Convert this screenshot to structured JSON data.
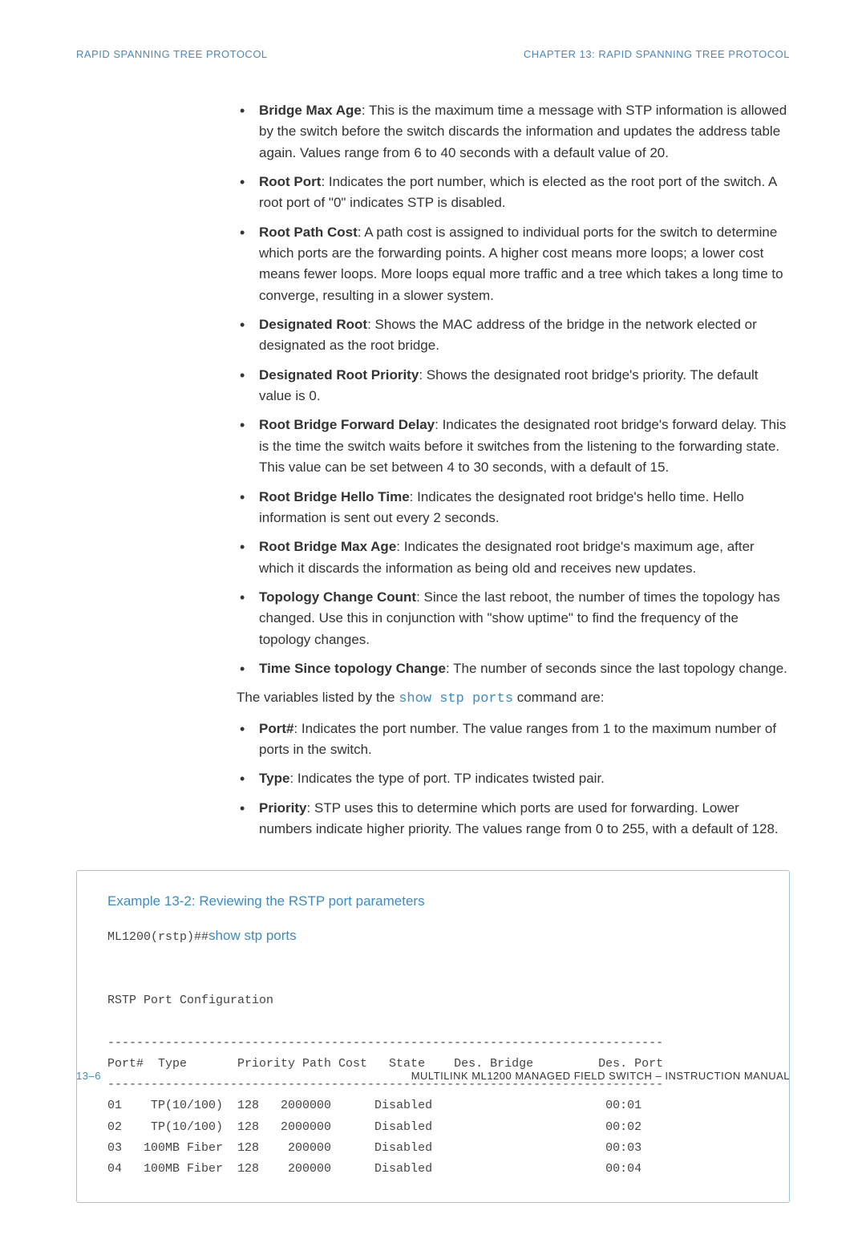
{
  "header": {
    "left": "RAPID SPANNING TREE PROTOCOL",
    "right": "CHAPTER 13: RAPID SPANNING TREE PROTOCOL"
  },
  "definitions_1": [
    {
      "term": "Bridge Max Age",
      "desc": ": This is the maximum time a message with STP information is allowed by the switch before the switch discards the information and updates the address table again. Values range from 6 to 40 seconds with a default value of 20."
    },
    {
      "term": "Root Port",
      "desc": ":  Indicates the port number, which is elected as the root port of the switch. A root port of \"0\" indicates STP is disabled."
    },
    {
      "term": "Root Path Cost",
      "desc": ": A path cost is assigned to individual ports for the switch to determine which ports are the forwarding points. A higher cost means more loops; a lower cost means fewer loops.  More loops equal more traffic and a tree which takes a long time to converge, resulting in a slower system."
    },
    {
      "term": "Designated Root",
      "desc": ": Shows the MAC address of the bridge in the network elected or designated as the root bridge."
    },
    {
      "term": "Designated Root Priority",
      "desc": ": Shows the designated root bridge's priority. The default value is 0."
    },
    {
      "term": "Root Bridge Forward Delay",
      "desc": ": Indicates the designated root bridge's forward delay. This is the time the switch waits before it switches from the listening to the forwarding state.  This value can be set between 4 to 30 seconds, with a default of 15."
    },
    {
      "term": "Root Bridge Hello Time",
      "desc": ": Indicates the designated root bridge's hello time. Hello information is sent out every 2 seconds."
    },
    {
      "term": "Root Bridge Max Age",
      "desc": ": Indicates the designated root bridge's maximum age, after which it discards the information as being old and receives new updates."
    },
    {
      "term": "Topology Change Count",
      "desc": ": Since the last reboot, the number of times the topology has changed. Use this in conjunction with \"show uptime\" to find the frequency of the topology changes."
    },
    {
      "term": "Time Since topology Change",
      "desc": ": The number of seconds since the last topology change."
    }
  ],
  "mid_text": {
    "before": "The variables listed by the ",
    "cmd": "show stp ports",
    "after": " command are:"
  },
  "definitions_2": [
    {
      "term": "Port#",
      "desc": ": Indicates the port number. The value ranges from 1 to the maximum number of ports in the switch."
    },
    {
      "term": "Type",
      "desc": ": Indicates the type of port. TP indicates twisted pair."
    },
    {
      "term": "Priority",
      "desc": ": STP uses this to determine which ports are used for forwarding. Lower numbers indicate higher priority. The values range from 0 to 255, with a default of 128."
    }
  ],
  "example": {
    "title": "Example 13-2: Reviewing the RSTP port parameters",
    "prompt": "ML1200(rstp)##",
    "cmd": "show stp ports",
    "body_intro": "RSTP Port Configuration",
    "divider": "-----------------------------------------------------------------------------",
    "columns": "Port#  Type       Priority Path Cost   State    Des. Bridge         Des. Port",
    "rows": [
      "01    TP(10/100)  128   2000000      Disabled                        00:01",
      "02    TP(10/100)  128   2000000      Disabled                        00:02",
      "03   100MB Fiber  128    200000      Disabled                        00:03",
      "04   100MB Fiber  128    200000      Disabled                        00:04"
    ]
  },
  "footer": {
    "page": "13–6",
    "doc": "MULTILINK ML1200 MANAGED FIELD SWITCH – INSTRUCTION MANUAL"
  }
}
